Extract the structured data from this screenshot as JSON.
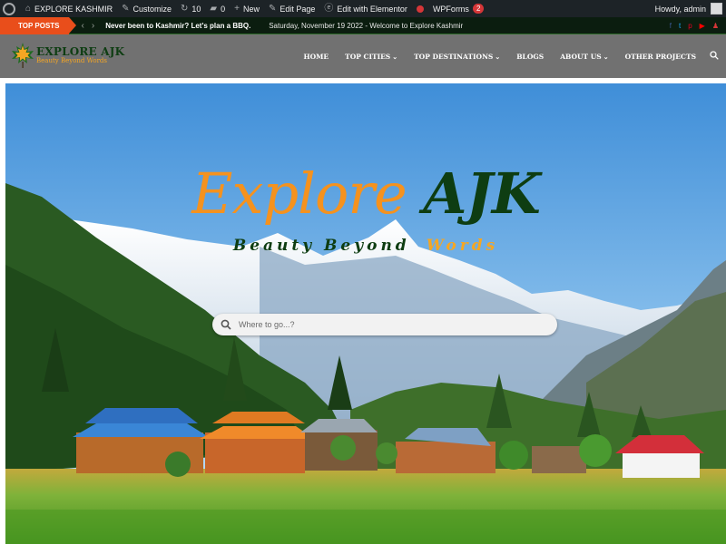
{
  "admin_bar": {
    "site_name": "EXPLORE KASHMIR",
    "customize": "Customize",
    "updates_count": "10",
    "comments_count": "0",
    "new_label": "New",
    "edit_page": "Edit Page",
    "edit_elementor": "Edit with Elementor",
    "wpforms": "WPForms",
    "wpforms_badge": "2",
    "howdy": "Howdy, admin"
  },
  "ticker": {
    "label": "TOP POSTS",
    "prev_icon": "‹",
    "next_icon": "›",
    "post": "Never been to Kashmir? Let's plan a BBQ...",
    "date_line": "Saturday, November 19 2022 - Welcome to Explore Kashmir",
    "social": [
      "f",
      "t",
      "p",
      "▶",
      "♟"
    ]
  },
  "header": {
    "logo_title": "EXPLORE AJK",
    "logo_tagline": "Beauty Beyond Words",
    "nav": [
      {
        "label": "HOME",
        "caret": ""
      },
      {
        "label": "TOP CITIES",
        "caret": "⌄"
      },
      {
        "label": "TOP DESTINATIONS",
        "caret": "⌄"
      },
      {
        "label": "BLOGS",
        "caret": ""
      },
      {
        "label": "ABOUT US",
        "caret": "⌄"
      },
      {
        "label": "OTHER PROJECTS",
        "caret": ""
      }
    ]
  },
  "hero": {
    "title_part1": "Explore",
    "title_part2": "AJK",
    "subtitle_part1": "Beauty Beyond",
    "subtitle_part2": "Words",
    "search_placeholder": "Where to go...?"
  },
  "colors": {
    "admin_bar_bg": "#1d2327",
    "ticker_label_bg": "#e94e1b",
    "header_bg": "#717171",
    "brand_orange": "#f5921e",
    "brand_green": "#0e3d12"
  }
}
